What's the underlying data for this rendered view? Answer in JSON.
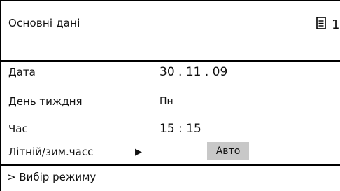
{
  "header": {
    "title": "Основні дані",
    "icon_name": "menu-page-icon",
    "page_number": "1"
  },
  "rows": [
    {
      "label": "Дата",
      "value": "30 . 11 . 09"
    },
    {
      "label": "День тиждня",
      "value": "Пн"
    },
    {
      "label": "Час",
      "value": "15 : 15"
    },
    {
      "label": "Літній/зим.часс",
      "value": "Авто"
    }
  ],
  "footer": {
    "text": "> Вибір режиму"
  },
  "colors": {
    "border": "#000000",
    "selected_background": "#c8c8c8"
  }
}
